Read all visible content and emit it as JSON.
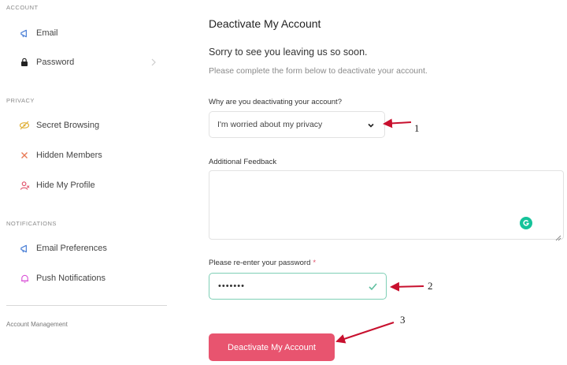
{
  "sidebar": {
    "sections": [
      {
        "title": "ACCOUNT",
        "items": [
          {
            "label": "Email",
            "icon": "megaphone-icon"
          },
          {
            "label": "Password",
            "icon": "lock-icon"
          }
        ]
      },
      {
        "title": "PRIVACY",
        "items": [
          {
            "label": "Secret Browsing",
            "icon": "eye-slash-icon"
          },
          {
            "label": "Hidden Members",
            "icon": "x-icon"
          },
          {
            "label": "Hide My Profile",
            "icon": "user-icon"
          }
        ]
      },
      {
        "title": "NOTIFICATIONS",
        "items": [
          {
            "label": "Email Preferences",
            "icon": "megaphone-icon"
          },
          {
            "label": "Push Notifications",
            "icon": "bell-icon"
          }
        ]
      }
    ],
    "footer_label": "Account Management"
  },
  "main": {
    "title": "Deactivate My Account",
    "subtitle": "Sorry to see you leaving us so soon.",
    "description": "Please complete the form below to deactivate your account.",
    "reason_label": "Why are you deactivating your account?",
    "reason_value": "I'm worried about my privacy",
    "feedback_label": "Additional Feedback",
    "password_label": "Please re-enter your password",
    "password_required_marker": "*",
    "password_value": "•••••••",
    "submit_label": "Deactivate My Account"
  },
  "annotations": {
    "step1": "1",
    "step2": "2",
    "step3": "3"
  },
  "colors": {
    "accent": "#e8546f",
    "success": "#7fcfb6",
    "grammarly": "#15c39a"
  }
}
